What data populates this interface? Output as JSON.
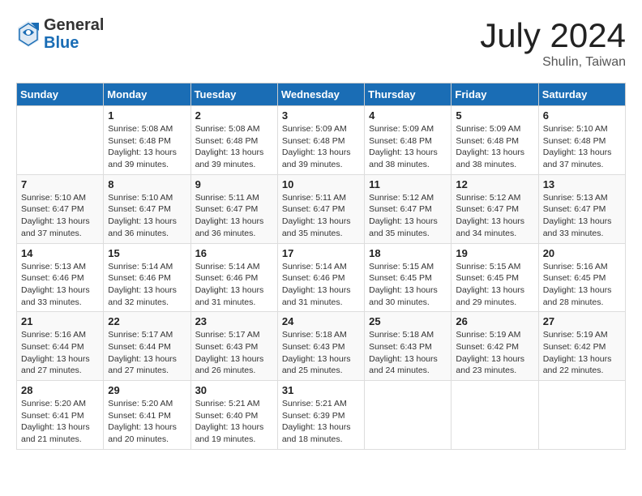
{
  "header": {
    "logo_general": "General",
    "logo_blue": "Blue",
    "month_year": "July 2024",
    "location": "Shulin, Taiwan"
  },
  "days_of_week": [
    "Sunday",
    "Monday",
    "Tuesday",
    "Wednesday",
    "Thursday",
    "Friday",
    "Saturday"
  ],
  "weeks": [
    [
      {
        "day": "",
        "sunrise": "",
        "sunset": "",
        "daylight": ""
      },
      {
        "day": "1",
        "sunrise": "Sunrise: 5:08 AM",
        "sunset": "Sunset: 6:48 PM",
        "daylight": "Daylight: 13 hours and 39 minutes."
      },
      {
        "day": "2",
        "sunrise": "Sunrise: 5:08 AM",
        "sunset": "Sunset: 6:48 PM",
        "daylight": "Daylight: 13 hours and 39 minutes."
      },
      {
        "day": "3",
        "sunrise": "Sunrise: 5:09 AM",
        "sunset": "Sunset: 6:48 PM",
        "daylight": "Daylight: 13 hours and 39 minutes."
      },
      {
        "day": "4",
        "sunrise": "Sunrise: 5:09 AM",
        "sunset": "Sunset: 6:48 PM",
        "daylight": "Daylight: 13 hours and 38 minutes."
      },
      {
        "day": "5",
        "sunrise": "Sunrise: 5:09 AM",
        "sunset": "Sunset: 6:48 PM",
        "daylight": "Daylight: 13 hours and 38 minutes."
      },
      {
        "day": "6",
        "sunrise": "Sunrise: 5:10 AM",
        "sunset": "Sunset: 6:48 PM",
        "daylight": "Daylight: 13 hours and 37 minutes."
      }
    ],
    [
      {
        "day": "7",
        "sunrise": "Sunrise: 5:10 AM",
        "sunset": "Sunset: 6:47 PM",
        "daylight": "Daylight: 13 hours and 37 minutes."
      },
      {
        "day": "8",
        "sunrise": "Sunrise: 5:10 AM",
        "sunset": "Sunset: 6:47 PM",
        "daylight": "Daylight: 13 hours and 36 minutes."
      },
      {
        "day": "9",
        "sunrise": "Sunrise: 5:11 AM",
        "sunset": "Sunset: 6:47 PM",
        "daylight": "Daylight: 13 hours and 36 minutes."
      },
      {
        "day": "10",
        "sunrise": "Sunrise: 5:11 AM",
        "sunset": "Sunset: 6:47 PM",
        "daylight": "Daylight: 13 hours and 35 minutes."
      },
      {
        "day": "11",
        "sunrise": "Sunrise: 5:12 AM",
        "sunset": "Sunset: 6:47 PM",
        "daylight": "Daylight: 13 hours and 35 minutes."
      },
      {
        "day": "12",
        "sunrise": "Sunrise: 5:12 AM",
        "sunset": "Sunset: 6:47 PM",
        "daylight": "Daylight: 13 hours and 34 minutes."
      },
      {
        "day": "13",
        "sunrise": "Sunrise: 5:13 AM",
        "sunset": "Sunset: 6:47 PM",
        "daylight": "Daylight: 13 hours and 33 minutes."
      }
    ],
    [
      {
        "day": "14",
        "sunrise": "Sunrise: 5:13 AM",
        "sunset": "Sunset: 6:46 PM",
        "daylight": "Daylight: 13 hours and 33 minutes."
      },
      {
        "day": "15",
        "sunrise": "Sunrise: 5:14 AM",
        "sunset": "Sunset: 6:46 PM",
        "daylight": "Daylight: 13 hours and 32 minutes."
      },
      {
        "day": "16",
        "sunrise": "Sunrise: 5:14 AM",
        "sunset": "Sunset: 6:46 PM",
        "daylight": "Daylight: 13 hours and 31 minutes."
      },
      {
        "day": "17",
        "sunrise": "Sunrise: 5:14 AM",
        "sunset": "Sunset: 6:46 PM",
        "daylight": "Daylight: 13 hours and 31 minutes."
      },
      {
        "day": "18",
        "sunrise": "Sunrise: 5:15 AM",
        "sunset": "Sunset: 6:45 PM",
        "daylight": "Daylight: 13 hours and 30 minutes."
      },
      {
        "day": "19",
        "sunrise": "Sunrise: 5:15 AM",
        "sunset": "Sunset: 6:45 PM",
        "daylight": "Daylight: 13 hours and 29 minutes."
      },
      {
        "day": "20",
        "sunrise": "Sunrise: 5:16 AM",
        "sunset": "Sunset: 6:45 PM",
        "daylight": "Daylight: 13 hours and 28 minutes."
      }
    ],
    [
      {
        "day": "21",
        "sunrise": "Sunrise: 5:16 AM",
        "sunset": "Sunset: 6:44 PM",
        "daylight": "Daylight: 13 hours and 27 minutes."
      },
      {
        "day": "22",
        "sunrise": "Sunrise: 5:17 AM",
        "sunset": "Sunset: 6:44 PM",
        "daylight": "Daylight: 13 hours and 27 minutes."
      },
      {
        "day": "23",
        "sunrise": "Sunrise: 5:17 AM",
        "sunset": "Sunset: 6:43 PM",
        "daylight": "Daylight: 13 hours and 26 minutes."
      },
      {
        "day": "24",
        "sunrise": "Sunrise: 5:18 AM",
        "sunset": "Sunset: 6:43 PM",
        "daylight": "Daylight: 13 hours and 25 minutes."
      },
      {
        "day": "25",
        "sunrise": "Sunrise: 5:18 AM",
        "sunset": "Sunset: 6:43 PM",
        "daylight": "Daylight: 13 hours and 24 minutes."
      },
      {
        "day": "26",
        "sunrise": "Sunrise: 5:19 AM",
        "sunset": "Sunset: 6:42 PM",
        "daylight": "Daylight: 13 hours and 23 minutes."
      },
      {
        "day": "27",
        "sunrise": "Sunrise: 5:19 AM",
        "sunset": "Sunset: 6:42 PM",
        "daylight": "Daylight: 13 hours and 22 minutes."
      }
    ],
    [
      {
        "day": "28",
        "sunrise": "Sunrise: 5:20 AM",
        "sunset": "Sunset: 6:41 PM",
        "daylight": "Daylight: 13 hours and 21 minutes."
      },
      {
        "day": "29",
        "sunrise": "Sunrise: 5:20 AM",
        "sunset": "Sunset: 6:41 PM",
        "daylight": "Daylight: 13 hours and 20 minutes."
      },
      {
        "day": "30",
        "sunrise": "Sunrise: 5:21 AM",
        "sunset": "Sunset: 6:40 PM",
        "daylight": "Daylight: 13 hours and 19 minutes."
      },
      {
        "day": "31",
        "sunrise": "Sunrise: 5:21 AM",
        "sunset": "Sunset: 6:39 PM",
        "daylight": "Daylight: 13 hours and 18 minutes."
      },
      {
        "day": "",
        "sunrise": "",
        "sunset": "",
        "daylight": ""
      },
      {
        "day": "",
        "sunrise": "",
        "sunset": "",
        "daylight": ""
      },
      {
        "day": "",
        "sunrise": "",
        "sunset": "",
        "daylight": ""
      }
    ]
  ]
}
